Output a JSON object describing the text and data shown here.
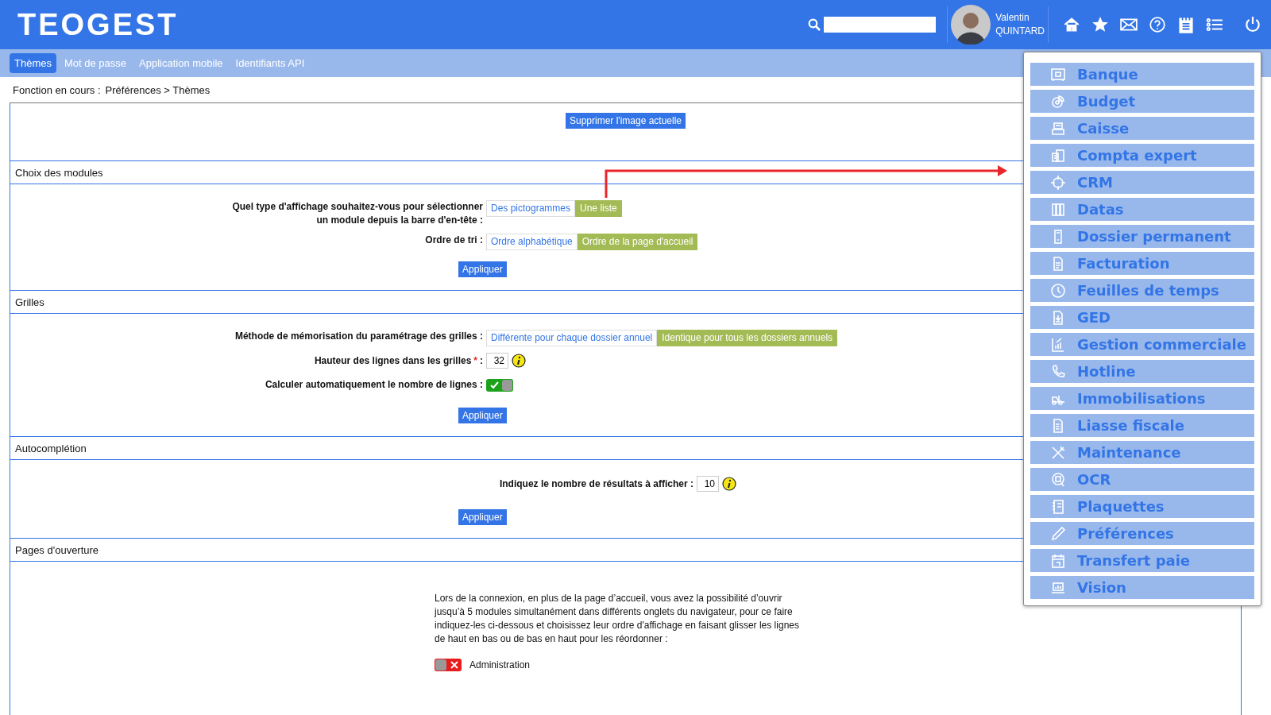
{
  "header": {
    "logo": "TEOGEST",
    "user": {
      "first_name": "Valentin",
      "last_name": "QUINTARD"
    }
  },
  "tabs": [
    {
      "label": "Thèmes",
      "selected": true
    },
    {
      "label": "Mot de passe",
      "selected": false
    },
    {
      "label": "Application mobile",
      "selected": false
    },
    {
      "label": "Identifiants API",
      "selected": false
    }
  ],
  "breadcrumb": {
    "label": "Fonction en cours :",
    "path": "Préférences > Thèmes"
  },
  "image_panel": {
    "button": "Supprimer l'image actuelle"
  },
  "modules": {
    "title": "Choix des modules",
    "rows": [
      {
        "label_lines": [
          "Quel type d'affichage souhaitez-vous pour sélectionner",
          "un module depuis la barre d'en-tête :"
        ],
        "options": [
          {
            "label": "Des pictogrammes",
            "selected": false
          },
          {
            "label": "Une liste",
            "selected": true
          }
        ]
      },
      {
        "label_lines": [
          "Ordre de tri :"
        ],
        "options": [
          {
            "label": "Ordre alphabétique",
            "selected": false
          },
          {
            "label": "Ordre de la page d'accueil",
            "selected": true
          }
        ]
      }
    ],
    "apply": "Appliquer"
  },
  "grids": {
    "title": "Grilles",
    "memorisation": {
      "label": "Méthode de mémorisation du paramétrage des grilles :",
      "options": [
        {
          "label": "Différente pour chaque dossier annuel",
          "selected": false
        },
        {
          "label": "Identique pour tous les dossiers annuels",
          "selected": true
        }
      ]
    },
    "row_height": {
      "label": "Hauteur des lignes dans les grilles",
      "required_mark": "*",
      "colon": ":",
      "value": "32"
    },
    "auto_count": {
      "label": "Calculer automatiquement le nombre de lignes :",
      "on": true
    },
    "apply": "Appliquer"
  },
  "autocompletion": {
    "title": "Autocomplétion",
    "count": {
      "label": "Indiquez le nombre de résultats à afficher :",
      "value": "10"
    },
    "apply": "Appliquer"
  },
  "opening_pages": {
    "title": "Pages d'ouverture",
    "text": "Lors de la connexion, en plus de la page d’accueil, vous avez la possibilité d’ouvrir jusqu’à 5 modules simultanément dans différents onglets du navigateur, pour ce faire indiquez-les ci-dessous et choisissez leur ordre d'affichage en faisant glisser les lignes de haut en bas ou de bas en haut pour les réordonner :",
    "modules": [
      {
        "label": "Administration",
        "on": false
      }
    ]
  },
  "module_menu": [
    {
      "label": "Banque"
    },
    {
      "label": "Budget"
    },
    {
      "label": "Caisse"
    },
    {
      "label": "Compta expert"
    },
    {
      "label": "CRM"
    },
    {
      "label": "Datas"
    },
    {
      "label": "Dossier permanent"
    },
    {
      "label": "Facturation"
    },
    {
      "label": "Feuilles de temps"
    },
    {
      "label": "GED"
    },
    {
      "label": "Gestion commerciale"
    },
    {
      "label": "Hotline"
    },
    {
      "label": "Immobilisations"
    },
    {
      "label": "Liasse fiscale"
    },
    {
      "label": "Maintenance"
    },
    {
      "label": "OCR"
    },
    {
      "label": "Plaquettes"
    },
    {
      "label": "Préférences"
    },
    {
      "label": "Transfert paie"
    },
    {
      "label": "Vision"
    }
  ]
}
